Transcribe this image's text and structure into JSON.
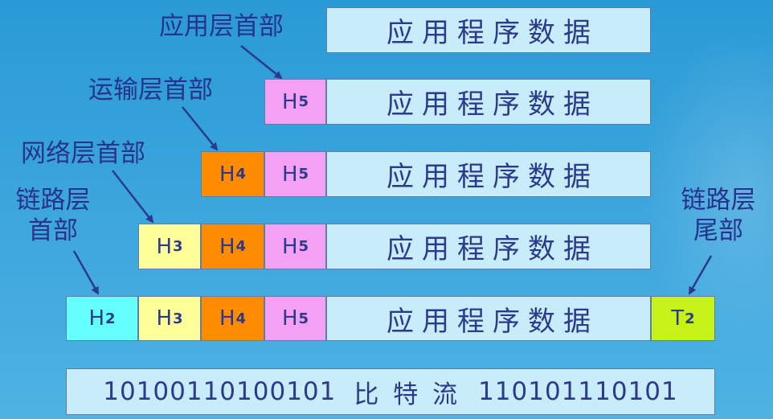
{
  "data_text": "应用程序数据",
  "headers": {
    "h5": {
      "letter": "H",
      "sub": "5"
    },
    "h4": {
      "letter": "H",
      "sub": "4"
    },
    "h3": {
      "letter": "H",
      "sub": "3"
    },
    "h2": {
      "letter": "H",
      "sub": "2"
    },
    "t2": {
      "letter": "T",
      "sub": "2"
    }
  },
  "labels": {
    "app_header": "应用层首部",
    "transport_header": "运输层首部",
    "network_header": "网络层首部",
    "link_header_line1": "链路层",
    "link_header_line2": "首部",
    "link_trailer_line1": "链路层",
    "link_trailer_line2": "尾部"
  },
  "bitstream": {
    "left": "10100110100101",
    "middle": "比 特 流",
    "right": "110101110101"
  },
  "colors": {
    "background": "#2e9ed9",
    "data_box": "#c9ecfb",
    "h5": "#f4a0f4",
    "h4": "#ff8c00",
    "h3": "#ffff99",
    "h2": "#66ffff",
    "t2": "#c6f21a",
    "text": "#27348b"
  }
}
